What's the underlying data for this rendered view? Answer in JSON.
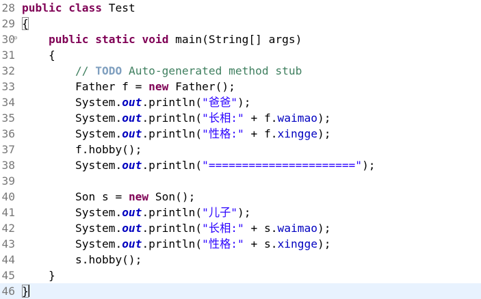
{
  "editor": {
    "lines": [
      {
        "num": "28",
        "tokens": [
          {
            "t": "kw",
            "v": "public"
          },
          {
            "t": "p",
            "v": " "
          },
          {
            "t": "kw",
            "v": "class"
          },
          {
            "t": "p",
            "v": " Test"
          }
        ]
      },
      {
        "num": "29",
        "tokens": [
          {
            "t": "bracket",
            "v": "{"
          }
        ]
      },
      {
        "num": "30",
        "fold": "⊖",
        "tokens": [
          {
            "t": "p",
            "v": "    "
          },
          {
            "t": "kw",
            "v": "public"
          },
          {
            "t": "p",
            "v": " "
          },
          {
            "t": "kw",
            "v": "static"
          },
          {
            "t": "p",
            "v": " "
          },
          {
            "t": "kw",
            "v": "void"
          },
          {
            "t": "p",
            "v": " main(String[] args)"
          }
        ]
      },
      {
        "num": "31",
        "tokens": [
          {
            "t": "p",
            "v": "    {"
          }
        ]
      },
      {
        "num": "32",
        "tokens": [
          {
            "t": "p",
            "v": "        "
          },
          {
            "t": "cm",
            "v": "// "
          },
          {
            "t": "todo",
            "v": "TODO"
          },
          {
            "t": "cm",
            "v": " Auto-generated method stub"
          }
        ]
      },
      {
        "num": "33",
        "tokens": [
          {
            "t": "p",
            "v": "        Father f = "
          },
          {
            "t": "kw",
            "v": "new"
          },
          {
            "t": "p",
            "v": " Father();"
          }
        ]
      },
      {
        "num": "34",
        "tokens": [
          {
            "t": "p",
            "v": "        System."
          },
          {
            "t": "sfld",
            "v": "out"
          },
          {
            "t": "p",
            "v": ".println("
          },
          {
            "t": "str",
            "v": "\"爸爸\""
          },
          {
            "t": "p",
            "v": ");"
          }
        ]
      },
      {
        "num": "35",
        "tokens": [
          {
            "t": "p",
            "v": "        System."
          },
          {
            "t": "sfld",
            "v": "out"
          },
          {
            "t": "p",
            "v": ".println("
          },
          {
            "t": "str",
            "v": "\"长相:\""
          },
          {
            "t": "p",
            "v": " + f."
          },
          {
            "t": "fld",
            "v": "waimao"
          },
          {
            "t": "p",
            "v": ");"
          }
        ]
      },
      {
        "num": "36",
        "tokens": [
          {
            "t": "p",
            "v": "        System."
          },
          {
            "t": "sfld",
            "v": "out"
          },
          {
            "t": "p",
            "v": ".println("
          },
          {
            "t": "str",
            "v": "\"性格:\""
          },
          {
            "t": "p",
            "v": " + f."
          },
          {
            "t": "fld",
            "v": "xingge"
          },
          {
            "t": "p",
            "v": ");"
          }
        ]
      },
      {
        "num": "37",
        "tokens": [
          {
            "t": "p",
            "v": "        f.hobby();"
          }
        ]
      },
      {
        "num": "38",
        "tokens": [
          {
            "t": "p",
            "v": "        System."
          },
          {
            "t": "sfld",
            "v": "out"
          },
          {
            "t": "p",
            "v": ".println("
          },
          {
            "t": "str",
            "v": "\"======================\""
          },
          {
            "t": "p",
            "v": ");"
          }
        ]
      },
      {
        "num": "39",
        "tokens": []
      },
      {
        "num": "40",
        "tokens": [
          {
            "t": "p",
            "v": "        Son s = "
          },
          {
            "t": "kw",
            "v": "new"
          },
          {
            "t": "p",
            "v": " Son();"
          }
        ]
      },
      {
        "num": "41",
        "tokens": [
          {
            "t": "p",
            "v": "        System."
          },
          {
            "t": "sfld",
            "v": "out"
          },
          {
            "t": "p",
            "v": ".println("
          },
          {
            "t": "str",
            "v": "\"儿子\""
          },
          {
            "t": "p",
            "v": ");"
          }
        ]
      },
      {
        "num": "42",
        "tokens": [
          {
            "t": "p",
            "v": "        System."
          },
          {
            "t": "sfld",
            "v": "out"
          },
          {
            "t": "p",
            "v": ".println("
          },
          {
            "t": "str",
            "v": "\"长相:\""
          },
          {
            "t": "p",
            "v": " + s."
          },
          {
            "t": "fld",
            "v": "waimao"
          },
          {
            "t": "p",
            "v": ");"
          }
        ]
      },
      {
        "num": "43",
        "tokens": [
          {
            "t": "p",
            "v": "        System."
          },
          {
            "t": "sfld",
            "v": "out"
          },
          {
            "t": "p",
            "v": ".println("
          },
          {
            "t": "str",
            "v": "\"性格:\""
          },
          {
            "t": "p",
            "v": " + s."
          },
          {
            "t": "fld",
            "v": "xingge"
          },
          {
            "t": "p",
            "v": ");"
          }
        ]
      },
      {
        "num": "44",
        "tokens": [
          {
            "t": "p",
            "v": "        s.hobby();"
          }
        ]
      },
      {
        "num": "45",
        "tokens": [
          {
            "t": "p",
            "v": "    }"
          }
        ]
      },
      {
        "num": "46",
        "current": true,
        "tokens": [
          {
            "t": "bracket",
            "v": "}"
          },
          {
            "t": "caret",
            "v": ""
          }
        ]
      }
    ]
  },
  "colors": {
    "keyword": "#7f0055",
    "comment": "#3f7f5f",
    "todo": "#7f9fbf",
    "string": "#2a00ff",
    "field": "#0000c0",
    "line_number": "#787878",
    "current_line": "#e8f2fe"
  }
}
